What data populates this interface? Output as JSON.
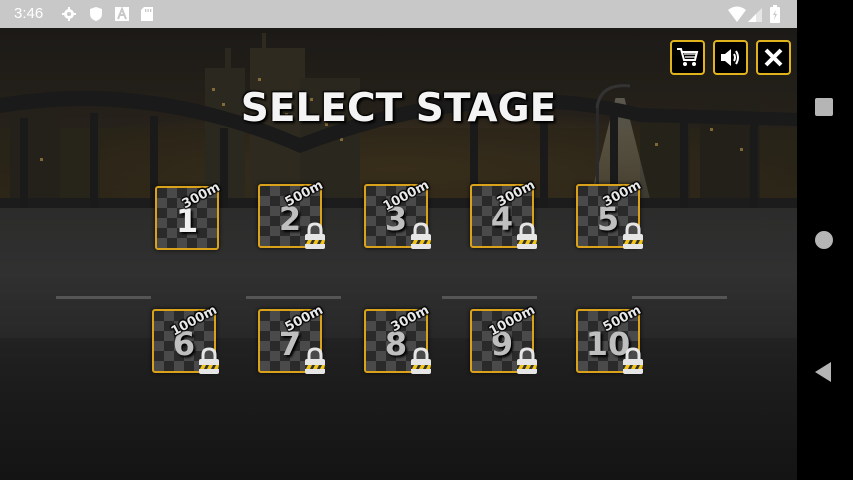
{
  "status_bar": {
    "time": "3:46",
    "icons": [
      "gear-icon",
      "shield-icon",
      "a-icon",
      "sd-card-icon",
      "wifi-icon",
      "signal-icon",
      "battery-icon"
    ]
  },
  "game": {
    "title": "SELECT STAGE",
    "buttons": [
      "cart-icon",
      "speaker-icon",
      "close-icon"
    ],
    "accent_color": "#d9a21a",
    "stages": [
      {
        "number": "1",
        "distance": "300m",
        "locked": false
      },
      {
        "number": "2",
        "distance": "500m",
        "locked": true
      },
      {
        "number": "3",
        "distance": "1000m",
        "locked": true
      },
      {
        "number": "4",
        "distance": "300m",
        "locked": true
      },
      {
        "number": "5",
        "distance": "300m",
        "locked": true
      },
      {
        "number": "6",
        "distance": "1000m",
        "locked": true
      },
      {
        "number": "7",
        "distance": "500m",
        "locked": true
      },
      {
        "number": "8",
        "distance": "300m",
        "locked": true
      },
      {
        "number": "9",
        "distance": "1000m",
        "locked": true
      },
      {
        "number": "10",
        "distance": "500m",
        "locked": true
      }
    ]
  },
  "nav_bar": {
    "buttons": [
      "recents-icon",
      "home-icon",
      "back-icon"
    ]
  }
}
